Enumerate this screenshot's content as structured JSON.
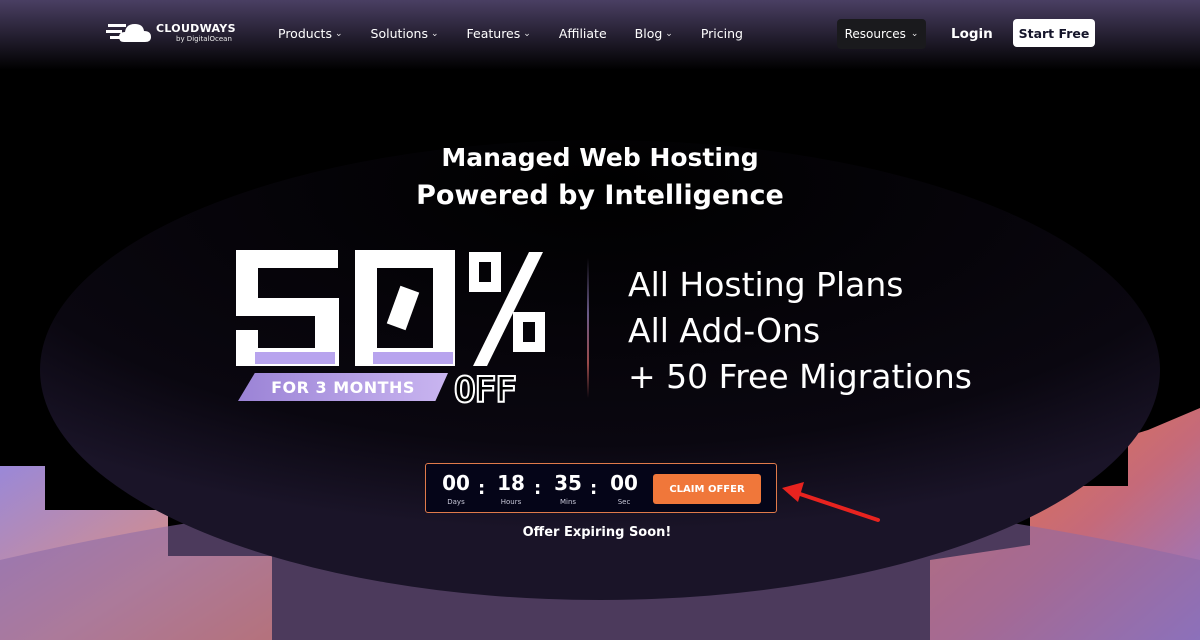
{
  "brand": {
    "name": "CLOUDWAYS",
    "sub": "by DigitalOcean"
  },
  "nav": {
    "items": [
      {
        "label": "Products",
        "has_dropdown": true
      },
      {
        "label": "Solutions",
        "has_dropdown": true
      },
      {
        "label": "Features",
        "has_dropdown": true
      },
      {
        "label": "Affiliate",
        "has_dropdown": false
      },
      {
        "label": "Blog",
        "has_dropdown": true
      },
      {
        "label": "Pricing",
        "has_dropdown": false
      }
    ],
    "resources_label": "Resources",
    "login_label": "Login",
    "start_free_label": "Start Free"
  },
  "hero": {
    "headline_1": "Managed Web Hosting",
    "headline_2": "Powered by Intelligence",
    "discount_number": "50",
    "discount_symbol": "%",
    "months_label": "FOR 3 MONTHS",
    "off_label": "OFF",
    "features": [
      "All Hosting Plans",
      "All Add-Ons",
      "+ 50 Free Migrations"
    ]
  },
  "countdown": {
    "days": "00",
    "days_label": "Days",
    "hours": "18",
    "hours_label": "Hours",
    "mins": "35",
    "mins_label": "Mins",
    "secs": "00",
    "secs_label": "Sec",
    "claim_label": "CLAIM OFFER",
    "expiring_label": "Offer Expiring Soon!"
  },
  "colors": {
    "accent_orange": "#f0773a",
    "lavender": "#9b83d6",
    "background": "#000000"
  }
}
